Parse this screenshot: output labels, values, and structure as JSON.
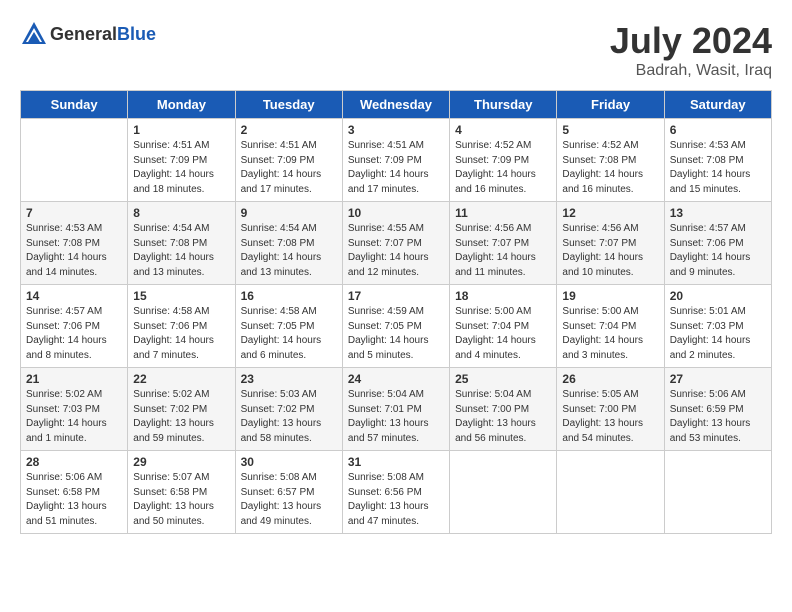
{
  "header": {
    "logo_general": "General",
    "logo_blue": "Blue",
    "title": "July 2024",
    "subtitle": "Badrah, Wasit, Iraq"
  },
  "days_of_week": [
    "Sunday",
    "Monday",
    "Tuesday",
    "Wednesday",
    "Thursday",
    "Friday",
    "Saturday"
  ],
  "weeks": [
    [
      {
        "day": "",
        "info": ""
      },
      {
        "day": "1",
        "info": "Sunrise: 4:51 AM\nSunset: 7:09 PM\nDaylight: 14 hours\nand 18 minutes."
      },
      {
        "day": "2",
        "info": "Sunrise: 4:51 AM\nSunset: 7:09 PM\nDaylight: 14 hours\nand 17 minutes."
      },
      {
        "day": "3",
        "info": "Sunrise: 4:51 AM\nSunset: 7:09 PM\nDaylight: 14 hours\nand 17 minutes."
      },
      {
        "day": "4",
        "info": "Sunrise: 4:52 AM\nSunset: 7:09 PM\nDaylight: 14 hours\nand 16 minutes."
      },
      {
        "day": "5",
        "info": "Sunrise: 4:52 AM\nSunset: 7:08 PM\nDaylight: 14 hours\nand 16 minutes."
      },
      {
        "day": "6",
        "info": "Sunrise: 4:53 AM\nSunset: 7:08 PM\nDaylight: 14 hours\nand 15 minutes."
      }
    ],
    [
      {
        "day": "7",
        "info": "Sunrise: 4:53 AM\nSunset: 7:08 PM\nDaylight: 14 hours\nand 14 minutes."
      },
      {
        "day": "8",
        "info": "Sunrise: 4:54 AM\nSunset: 7:08 PM\nDaylight: 14 hours\nand 13 minutes."
      },
      {
        "day": "9",
        "info": "Sunrise: 4:54 AM\nSunset: 7:08 PM\nDaylight: 14 hours\nand 13 minutes."
      },
      {
        "day": "10",
        "info": "Sunrise: 4:55 AM\nSunset: 7:07 PM\nDaylight: 14 hours\nand 12 minutes."
      },
      {
        "day": "11",
        "info": "Sunrise: 4:56 AM\nSunset: 7:07 PM\nDaylight: 14 hours\nand 11 minutes."
      },
      {
        "day": "12",
        "info": "Sunrise: 4:56 AM\nSunset: 7:07 PM\nDaylight: 14 hours\nand 10 minutes."
      },
      {
        "day": "13",
        "info": "Sunrise: 4:57 AM\nSunset: 7:06 PM\nDaylight: 14 hours\nand 9 minutes."
      }
    ],
    [
      {
        "day": "14",
        "info": "Sunrise: 4:57 AM\nSunset: 7:06 PM\nDaylight: 14 hours\nand 8 minutes."
      },
      {
        "day": "15",
        "info": "Sunrise: 4:58 AM\nSunset: 7:06 PM\nDaylight: 14 hours\nand 7 minutes."
      },
      {
        "day": "16",
        "info": "Sunrise: 4:58 AM\nSunset: 7:05 PM\nDaylight: 14 hours\nand 6 minutes."
      },
      {
        "day": "17",
        "info": "Sunrise: 4:59 AM\nSunset: 7:05 PM\nDaylight: 14 hours\nand 5 minutes."
      },
      {
        "day": "18",
        "info": "Sunrise: 5:00 AM\nSunset: 7:04 PM\nDaylight: 14 hours\nand 4 minutes."
      },
      {
        "day": "19",
        "info": "Sunrise: 5:00 AM\nSunset: 7:04 PM\nDaylight: 14 hours\nand 3 minutes."
      },
      {
        "day": "20",
        "info": "Sunrise: 5:01 AM\nSunset: 7:03 PM\nDaylight: 14 hours\nand 2 minutes."
      }
    ],
    [
      {
        "day": "21",
        "info": "Sunrise: 5:02 AM\nSunset: 7:03 PM\nDaylight: 14 hours\nand 1 minute."
      },
      {
        "day": "22",
        "info": "Sunrise: 5:02 AM\nSunset: 7:02 PM\nDaylight: 13 hours\nand 59 minutes."
      },
      {
        "day": "23",
        "info": "Sunrise: 5:03 AM\nSunset: 7:02 PM\nDaylight: 13 hours\nand 58 minutes."
      },
      {
        "day": "24",
        "info": "Sunrise: 5:04 AM\nSunset: 7:01 PM\nDaylight: 13 hours\nand 57 minutes."
      },
      {
        "day": "25",
        "info": "Sunrise: 5:04 AM\nSunset: 7:00 PM\nDaylight: 13 hours\nand 56 minutes."
      },
      {
        "day": "26",
        "info": "Sunrise: 5:05 AM\nSunset: 7:00 PM\nDaylight: 13 hours\nand 54 minutes."
      },
      {
        "day": "27",
        "info": "Sunrise: 5:06 AM\nSunset: 6:59 PM\nDaylight: 13 hours\nand 53 minutes."
      }
    ],
    [
      {
        "day": "28",
        "info": "Sunrise: 5:06 AM\nSunset: 6:58 PM\nDaylight: 13 hours\nand 51 minutes."
      },
      {
        "day": "29",
        "info": "Sunrise: 5:07 AM\nSunset: 6:58 PM\nDaylight: 13 hours\nand 50 minutes."
      },
      {
        "day": "30",
        "info": "Sunrise: 5:08 AM\nSunset: 6:57 PM\nDaylight: 13 hours\nand 49 minutes."
      },
      {
        "day": "31",
        "info": "Sunrise: 5:08 AM\nSunset: 6:56 PM\nDaylight: 13 hours\nand 47 minutes."
      },
      {
        "day": "",
        "info": ""
      },
      {
        "day": "",
        "info": ""
      },
      {
        "day": "",
        "info": ""
      }
    ]
  ]
}
